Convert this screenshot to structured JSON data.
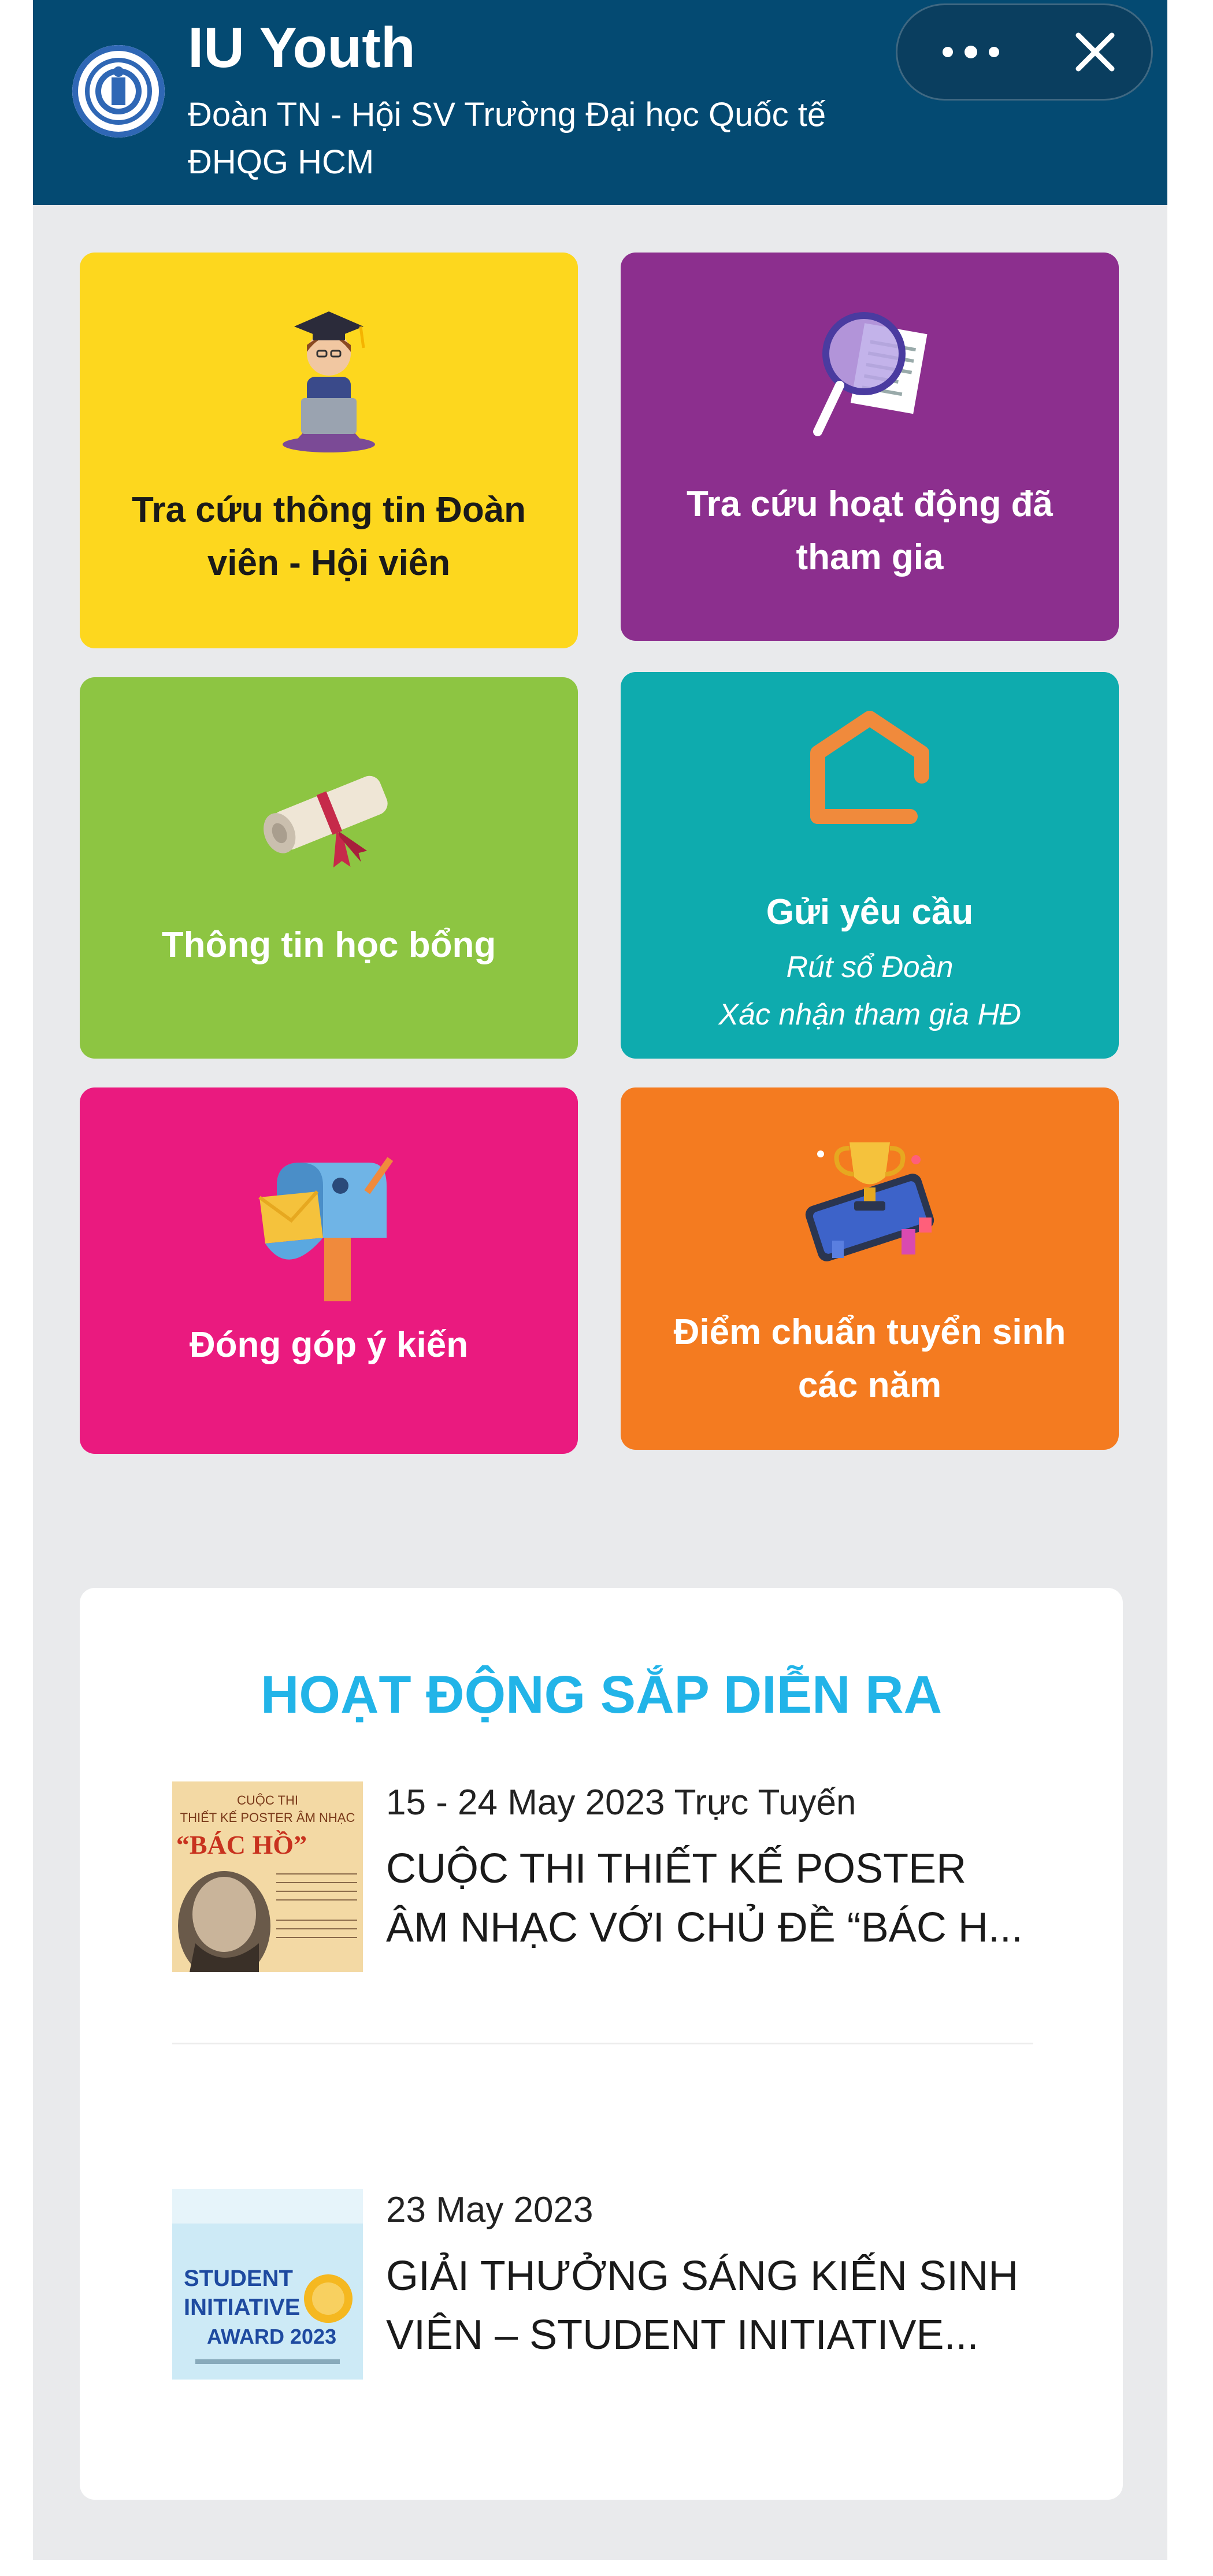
{
  "header": {
    "title": "IU Youth",
    "subtitle": "Đoàn TN - Hội SV Trường Đại học Quốc tế ĐHQG HCM",
    "logo_icon": "university-logo",
    "more_icon": "more-dots-icon",
    "close_icon": "close-icon",
    "background": "#044a72"
  },
  "tiles": [
    {
      "label": "Tra cứu thông tin Đoàn viên - Hội viên",
      "color": "#fdd71e",
      "icon": "graduate-icon"
    },
    {
      "label": "Tra cứu hoạt động đã tham gia",
      "color": "#8c2f8e",
      "icon": "magnifier-document-icon"
    },
    {
      "label": "Thông tin học bổng",
      "color": "#8dc542",
      "icon": "diploma-scroll-icon"
    },
    {
      "label": "Gửi yêu cầu",
      "sub1": "Rút sổ Đoàn",
      "sub2": "Xác nhận tham gia HĐ",
      "color": "#0eabae",
      "icon": "house-outline-icon"
    },
    {
      "label": "Đóng góp ý kiến",
      "color": "#ea1a7f",
      "icon": "mailbox-icon"
    },
    {
      "label": "Điểm chuẩn tuyển sinh các năm",
      "color": "#f47b20",
      "icon": "trophy-phone-icon"
    }
  ],
  "upcoming": {
    "title": "HOẠT ĐỘNG SẮP DIỄN RA",
    "title_color": "#22b4e8",
    "events": [
      {
        "date": "15 - 24 May 2023 Trực Tuyến",
        "title_line1": "CUỘC THI THIẾT KẾ POSTER",
        "title_line2": "ÂM NHẠC VỚI CHỦ ĐỀ “BÁC H...",
        "thumb_line1": "CUỘC THI",
        "thumb_line2": "THIẾT KẾ POSTER ÂM NHẠC",
        "thumb_line3": "“BÁC HỒ”"
      },
      {
        "date": "23 May 2023",
        "title_line1": "GIẢI THƯỞNG SÁNG KIẾN SINH",
        "title_line2": "VIÊN – STUDENT INITIATIVE...",
        "thumb_line1": "STUDENT",
        "thumb_line2": "INITIATIVE",
        "thumb_line3": "AWARD 2023"
      }
    ]
  }
}
